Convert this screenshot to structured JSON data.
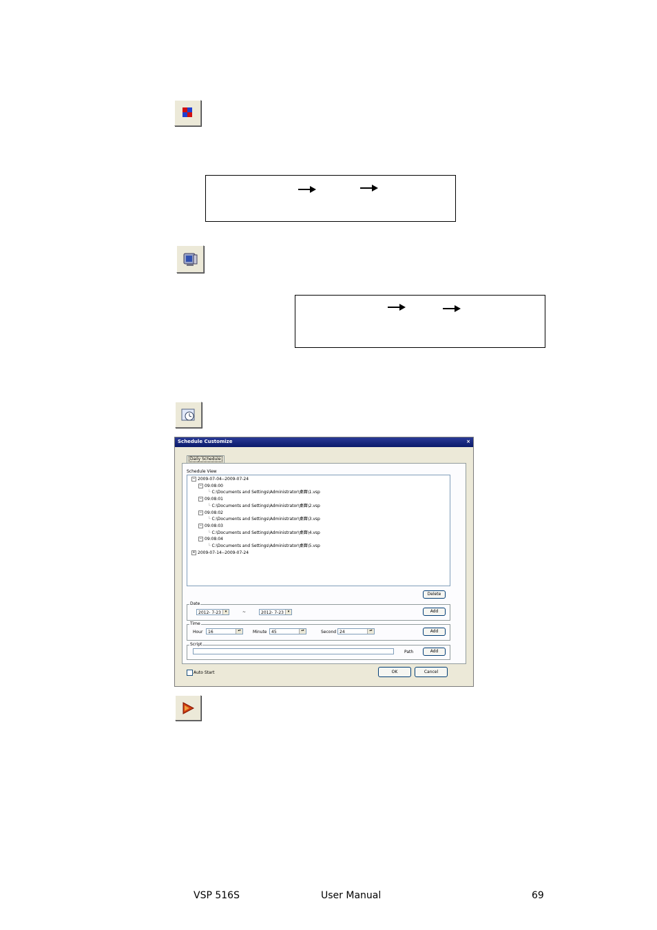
{
  "dialog": {
    "title": "Schedule Customize",
    "close_glyph": "×",
    "tab_label": "Daily Schedule",
    "schedule_view_label": "Schedule View",
    "tree": [
      {
        "pm": "⊟",
        "text": "2009-07-04--2009-07-24"
      },
      {
        "pm": "⊟",
        "text": "09:08:00"
      },
      {
        "pm": "",
        "text": "C:\\Documents and Settings\\Administrator\\桌面\\1.vsp"
      },
      {
        "pm": "⊟",
        "text": "09:08:01"
      },
      {
        "pm": "",
        "text": "C:\\Documents and Settings\\Administrator\\桌面\\2.vsp"
      },
      {
        "pm": "⊟",
        "text": "09:08:02"
      },
      {
        "pm": "",
        "text": "C:\\Documents and Settings\\Administrator\\桌面\\3.vsp"
      },
      {
        "pm": "⊟",
        "text": "09:08:03"
      },
      {
        "pm": "",
        "text": "C:\\Documents and Settings\\Administrator\\桌面\\4.vsp"
      },
      {
        "pm": "⊟",
        "text": "09:08:04"
      },
      {
        "pm": "",
        "text": "C:\\Documents and Settings\\Administrator\\桌面\\5.vsp"
      },
      {
        "pm": "⊞",
        "text": "2009-07-14--2009-07-24"
      }
    ],
    "delete_label": "Delete",
    "date_group": "Date",
    "date_from": "2012- 7-23",
    "date_sep": "~",
    "date_to": "2012- 7-23",
    "add_label": "Add",
    "time_group": "Time",
    "hour_label": "Hour",
    "hour_value": "16",
    "minute_label": "Minute",
    "minute_value": "45",
    "second_label": "Second",
    "second_value": "24",
    "script_group": "Script",
    "script_value": "",
    "path_label": "Path",
    "auto_start_label": "Auto Start",
    "auto_start_checked": false,
    "ok_label": "OK",
    "cancel_label": "Cancel",
    "dropdown_glyph": "▾",
    "spin_glyph": "▴▾"
  },
  "footer": {
    "product": "VSP 516S",
    "doc": "User Manual",
    "page": "69"
  },
  "icons": [
    "quad-color-icon",
    "monitor-icon",
    "schedule-clock-icon",
    "play-icon"
  ],
  "colors": {
    "titlebar": "#0a1a6a",
    "button_face": "#ece9d8"
  }
}
